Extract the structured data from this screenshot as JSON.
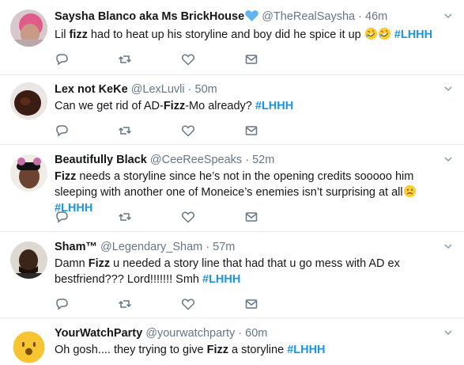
{
  "tweets": [
    {
      "name": "Saysha Blanco aka Ms BrickHouse",
      "handle": "@TheRealSaysha",
      "dot": "·",
      "time": "46m",
      "verified_emoji": "blue-heart-icon",
      "text_before": "Lil ",
      "highlight": "fizz",
      "text_after": " had to heat up his storyline and boy did he spice it up ",
      "emojis": [
        "rolling-laughing-icon",
        "rolling-laughing-icon"
      ],
      "hashtag": "#LHHH"
    },
    {
      "name": "Lex not KeKe",
      "handle": "@LexLuvli",
      "dot": "·",
      "time": "50m",
      "text_before": "Can we get rid of AD-",
      "highlight": "Fizz",
      "text_after": "-Mo already? ",
      "hashtag": "#LHHH"
    },
    {
      "name": "Beautifully Black",
      "handle": "@CeeReeSpeaks",
      "dot": "·",
      "time": "52m",
      "highlight": "Fizz",
      "text_after": " needs a storyline since he’s not in the opening credits sooooo him sleeping with another one of Moneice’s enemies isn’t surprising at all",
      "emojis": [
        "frowning-face-icon"
      ],
      "hashtag": "#LHHH"
    },
    {
      "name": "Sham™",
      "handle": "@Legendary_Sham",
      "dot": "·",
      "time": "57m",
      "text_before": "Damn ",
      "highlight": "Fizz",
      "text_after": " u needed a story line that had that u go mess with AD ex bestfriend??? Lord!!!!!!! Smh ",
      "hashtag": "#LHHH"
    },
    {
      "name": "YourWatchParty",
      "handle": "@yourwatchparty",
      "dot": "·",
      "time": "60m",
      "text_before": "Oh gosh.... they trying to give ",
      "highlight": "Fizz",
      "text_after": " a storyline ",
      "hashtag": "#LHHH"
    }
  ],
  "colors": {
    "text": "#14171a",
    "muted": "#657786",
    "hashtag": "#1b95e0",
    "divider": "#e6ecf0",
    "icon": "#657786"
  }
}
